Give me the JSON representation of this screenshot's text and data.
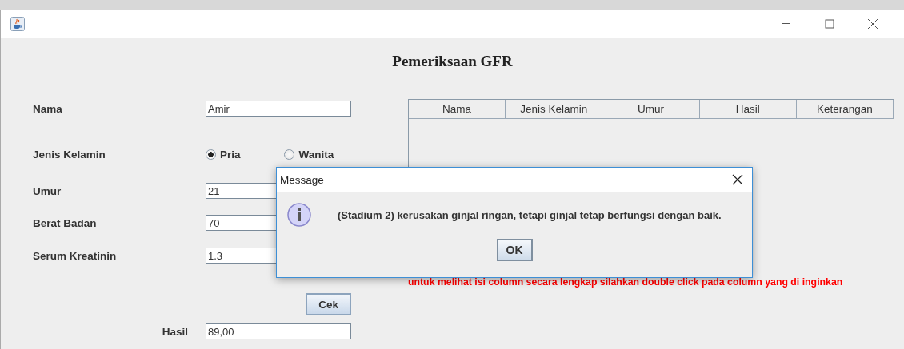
{
  "window": {
    "title": "Pemeriksaan GFR"
  },
  "form": {
    "fields": [
      {
        "kind": "text",
        "label": "Nama",
        "value": "Amir"
      },
      {
        "kind": "radio",
        "label": "Jenis Kelamin",
        "options": [
          {
            "label": "Pria",
            "selected": true
          },
          {
            "label": "Wanita",
            "selected": false
          }
        ]
      },
      {
        "kind": "text",
        "label": "Umur",
        "value": "21"
      },
      {
        "kind": "text",
        "label": "Berat Badan",
        "value": "70"
      },
      {
        "kind": "text",
        "label": "Serum Kreatinin",
        "value": "1.3"
      }
    ],
    "button": "Cek",
    "result": {
      "label": "Hasil",
      "value": "89,00"
    }
  },
  "table": {
    "columns": [
      "Nama",
      "Jenis Kelamin",
      "Umur",
      "Hasil",
      "Keterangan"
    ]
  },
  "note": "untuk melihat isi column secara lengkap silahkan double click pada column yang di inginkan",
  "dialog": {
    "title": "Message",
    "message": "(Stadium 2) kerusakan ginjal ringan, tetapi ginjal tetap berfungsi dengan baik.",
    "button": "OK"
  }
}
